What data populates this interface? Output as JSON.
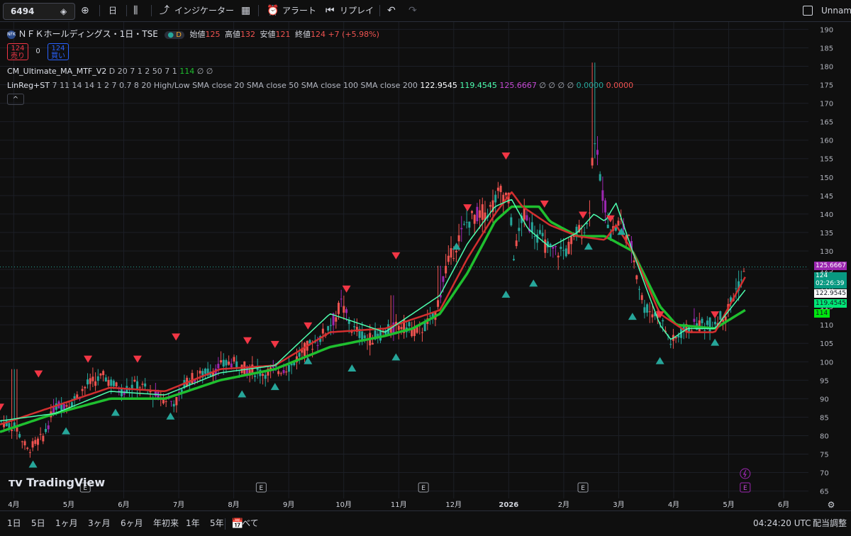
{
  "toolbar": {
    "symbol": "6494",
    "interval": "日",
    "indicators": "インジケーター",
    "alert": "アラート",
    "replay": "リプレイ",
    "layout_name": "Unname"
  },
  "legend": {
    "title": "ＮＦＫホールディングス・1日・TSE",
    "badge": "D",
    "open_label": "始値",
    "open": "125",
    "high_label": "高値",
    "high": "132",
    "low_label": "安値",
    "low": "121",
    "close_label": "終値",
    "close": "124",
    "change": "+7 (+5.98%)",
    "sell_price": "124",
    "sell_label": "売り",
    "spread": "0",
    "buy_price": "124",
    "buy_label": "買い",
    "ind1_name": "CM_Ultimate_MA_MTF_V2",
    "ind1_params": "D 20 7 1 2 50 7 1",
    "ind1_value": "114",
    "ind1_na": "∅  ∅",
    "ind2_name": "LinReg+ST",
    "ind2_params": "7 11 14 14 1 2 7 0.7 8 20 High/Low SMA close 20 SMA close 50 SMA close 100 SMA close 200",
    "ind2_v1": "122.9545",
    "ind2_v2": "119.4545",
    "ind2_v3": "125.6667",
    "ind2_na": "∅  ∅  ∅  ∅",
    "ind2_v4": "0.0000",
    "ind2_v5": "0.0000",
    "collapse": "^"
  },
  "watermark": "TradingView",
  "price_labels": {
    "p1": "125.6667",
    "p2_top": "124",
    "p2_bottom": "02:26:39",
    "p3": "122.9545",
    "p4": "119.4545",
    "p5": "114"
  },
  "earnings_marker": "E",
  "bottom": {
    "ranges": [
      "1日",
      "5日",
      "1ヶ月",
      "3ヶ月",
      "6ヶ月",
      "年初来",
      "1年",
      "5年",
      "すべて"
    ],
    "time": "04:24:20 UTC",
    "adjust": "配当調整"
  },
  "colors": {
    "up": "#26a69a",
    "down": "#ef5350",
    "ma_slow": "#1fbf2f",
    "ma_red": "#d32f2f",
    "ma_light": "#4dffaf",
    "sell": "#f23645",
    "buy": "#2962ff",
    "purple": "#9c27b0"
  },
  "chart_data": {
    "type": "candlestick",
    "title": "ＮＦＫホールディングス・1日・TSE",
    "ylim": [
      63,
      192
    ],
    "y_ticks": [
      65,
      70,
      75,
      80,
      85,
      90,
      95,
      100,
      105,
      110,
      115,
      120,
      125,
      130,
      135,
      140,
      145,
      150,
      155,
      160,
      165,
      170,
      175,
      180,
      185,
      190
    ],
    "x_ticks": [
      "4月",
      "5月",
      "6月",
      "7月",
      "8月",
      "9月",
      "10月",
      "11月",
      "12月",
      "2026",
      "2月",
      "3月",
      "4月",
      "5月",
      "6月"
    ],
    "x_tick_pos": [
      0.25,
      1.25,
      2.25,
      3.25,
      4.25,
      5.25,
      6.25,
      7.25,
      8.25,
      9.25,
      10.25,
      11.25,
      12.25,
      13.25,
      14.25
    ],
    "x_range": [
      0,
      14.7
    ],
    "price_path": [
      [
        0,
        84
      ],
      [
        0.3,
        82
      ],
      [
        0.5,
        76
      ],
      [
        0.8,
        80
      ],
      [
        1.0,
        88
      ],
      [
        1.3,
        89
      ],
      [
        1.6,
        94
      ],
      [
        1.9,
        96
      ],
      [
        2.2,
        92
      ],
      [
        2.5,
        94
      ],
      [
        2.8,
        91
      ],
      [
        3.0,
        90
      ],
      [
        3.2,
        89
      ],
      [
        3.4,
        95
      ],
      [
        3.6,
        96
      ],
      [
        3.9,
        98
      ],
      [
        4.2,
        100
      ],
      [
        4.5,
        98
      ],
      [
        4.8,
        97
      ],
      [
        5.1,
        98
      ],
      [
        5.3,
        99
      ],
      [
        5.5,
        103
      ],
      [
        5.8,
        106
      ],
      [
        6.1,
        112
      ],
      [
        6.2,
        116
      ],
      [
        6.4,
        109
      ],
      [
        6.7,
        106
      ],
      [
        7.0,
        108
      ],
      [
        7.3,
        110
      ],
      [
        7.6,
        108
      ],
      [
        7.9,
        112
      ],
      [
        8.1,
        125
      ],
      [
        8.3,
        132
      ],
      [
        8.5,
        138
      ],
      [
        8.7,
        140
      ],
      [
        8.9,
        141
      ],
      [
        9.1,
        146
      ],
      [
        9.25,
        144
      ],
      [
        9.35,
        128
      ],
      [
        9.5,
        140
      ],
      [
        9.8,
        134
      ],
      [
        10.0,
        130
      ],
      [
        10.3,
        130
      ],
      [
        10.5,
        135
      ],
      [
        10.7,
        137
      ],
      [
        10.8,
        163
      ],
      [
        10.9,
        150
      ],
      [
        11.1,
        135
      ],
      [
        11.3,
        138
      ],
      [
        11.5,
        130
      ],
      [
        11.7,
        115
      ],
      [
        12.0,
        112
      ],
      [
        12.2,
        105
      ],
      [
        12.4,
        108
      ],
      [
        12.6,
        110
      ],
      [
        12.9,
        110
      ],
      [
        13.2,
        113
      ],
      [
        13.4,
        120
      ],
      [
        13.55,
        124
      ]
    ],
    "series": [
      {
        "name": "CM_Ultimate_MA_MTF_V2",
        "values": [
          [
            0,
            81
          ],
          [
            1,
            86
          ],
          [
            2,
            90
          ],
          [
            3,
            90
          ],
          [
            4,
            95
          ],
          [
            5,
            98
          ],
          [
            6,
            104
          ],
          [
            7,
            107
          ],
          [
            7.5,
            109
          ],
          [
            8,
            113
          ],
          [
            8.5,
            124
          ],
          [
            9,
            138
          ],
          [
            9.3,
            142
          ],
          [
            9.8,
            142
          ],
          [
            10,
            138
          ],
          [
            10.5,
            134
          ],
          [
            11,
            134
          ],
          [
            11.5,
            130
          ],
          [
            12,
            115
          ],
          [
            12.3,
            110
          ],
          [
            13,
            109
          ],
          [
            13.55,
            114
          ]
        ]
      },
      {
        "name": "LinReg+ST",
        "values": [
          [
            0,
            83
          ],
          [
            1,
            88
          ],
          [
            2,
            93
          ],
          [
            3,
            92
          ],
          [
            4,
            98
          ],
          [
            5,
            99
          ],
          [
            6,
            108
          ],
          [
            7,
            109
          ],
          [
            8,
            114
          ],
          [
            8.5,
            128
          ],
          [
            9,
            140
          ],
          [
            9.3,
            146
          ],
          [
            9.5,
            142
          ],
          [
            10,
            137
          ],
          [
            10.5,
            134
          ],
          [
            11,
            133
          ],
          [
            11.2,
            137
          ],
          [
            11.5,
            130
          ],
          [
            12,
            113
          ],
          [
            12.5,
            108
          ],
          [
            13,
            108
          ],
          [
            13.55,
            122.9545
          ]
        ]
      },
      {
        "name": "LinReg+ST",
        "values": [
          [
            0,
            84
          ],
          [
            1,
            86
          ],
          [
            2,
            92
          ],
          [
            3,
            91
          ],
          [
            4,
            97
          ],
          [
            5,
            99
          ],
          [
            6,
            113
          ],
          [
            7,
            108
          ],
          [
            8,
            118
          ],
          [
            8.5,
            132
          ],
          [
            9,
            142
          ],
          [
            9.3,
            144
          ],
          [
            9.6,
            136
          ],
          [
            10,
            131
          ],
          [
            10.5,
            135
          ],
          [
            10.8,
            140
          ],
          [
            11,
            138
          ],
          [
            11.2,
            143
          ],
          [
            11.5,
            130
          ],
          [
            12,
            110
          ],
          [
            12.2,
            106
          ],
          [
            12.5,
            109
          ],
          [
            13,
            109
          ],
          [
            13.55,
            119.4545
          ]
        ]
      }
    ],
    "sell_signals": [
      [
        0.0,
        85
      ],
      [
        0.7,
        94
      ],
      [
        1.6,
        98
      ],
      [
        2.5,
        98
      ],
      [
        3.2,
        104
      ],
      [
        4.5,
        103
      ],
      [
        5.0,
        102
      ],
      [
        5.6,
        107
      ],
      [
        6.3,
        117
      ],
      [
        7.2,
        126
      ],
      [
        8.5,
        139
      ],
      [
        9.2,
        153
      ],
      [
        9.9,
        140
      ],
      [
        10.6,
        137
      ],
      [
        11.1,
        136
      ],
      [
        12.0,
        110
      ],
      [
        13.0,
        110
      ]
    ],
    "buy_signals": [
      [
        0.6,
        75
      ],
      [
        1.2,
        84
      ],
      [
        2.1,
        89
      ],
      [
        3.1,
        88
      ],
      [
        4.4,
        94
      ],
      [
        5.0,
        96
      ],
      [
        5.6,
        103
      ],
      [
        6.4,
        101
      ],
      [
        7.2,
        104
      ],
      [
        8.3,
        134
      ],
      [
        9.2,
        121
      ],
      [
        9.7,
        124
      ],
      [
        10.7,
        134
      ],
      [
        11.3,
        138
      ],
      [
        11.5,
        115
      ],
      [
        12.0,
        103
      ],
      [
        13.0,
        108
      ]
    ],
    "earnings_x": [
      1.55,
      4.75,
      7.7,
      10.6
    ],
    "last_price_line": 125.6667,
    "close": 124,
    "open": 125,
    "high": 132,
    "low": 121
  }
}
